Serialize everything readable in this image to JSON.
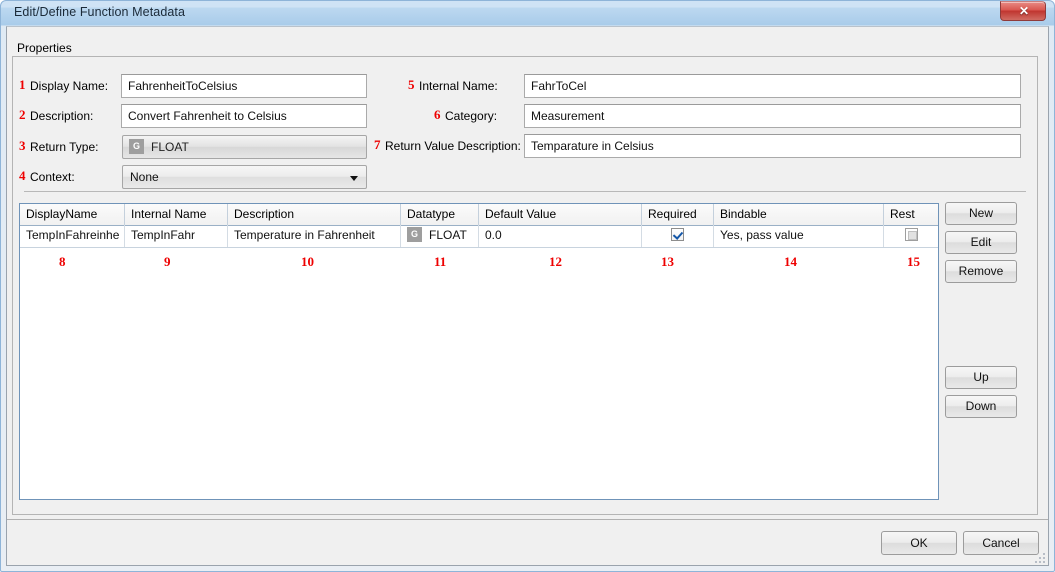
{
  "window": {
    "title": "Edit/Define Function Metadata",
    "close_label": "✕"
  },
  "group": {
    "title": "Properties"
  },
  "fields": {
    "display_name": {
      "number": "1",
      "label": "Display Name:",
      "value": "FahrenheitToCelsius"
    },
    "description": {
      "number": "2",
      "label": "Description:",
      "value": "Convert Fahrenheit to Celsius"
    },
    "return_type": {
      "number": "3",
      "label": "Return Type:",
      "badge": "G",
      "value": "FLOAT"
    },
    "context": {
      "number": "4",
      "label": "Context:",
      "value": "None"
    },
    "internal_name": {
      "number": "5",
      "label": "Internal Name:",
      "value": "FahrToCel"
    },
    "category": {
      "number": "6",
      "label": "Category:",
      "value": "Measurement"
    },
    "return_value_description": {
      "number": "7",
      "label": "Return Value Description:",
      "value": "Temparature in Celsius"
    }
  },
  "table": {
    "columns": [
      "DisplayName",
      "Internal Name",
      "Description",
      "Datatype",
      "Default Value",
      "Required",
      "Bindable",
      "Rest"
    ],
    "column_numbers": [
      "8",
      "9",
      "10",
      "11",
      "12",
      "13",
      "14",
      "15"
    ],
    "rows": [
      {
        "display_name": "TempInFahreinhe",
        "internal_name": "TempInFahr",
        "description": "Temperature in Fahrenheit",
        "datatype_badge": "G",
        "datatype": "FLOAT",
        "default_value": "0.0",
        "required_checked": true,
        "bindable": "Yes, pass value",
        "rest_checked": false
      }
    ]
  },
  "side_buttons": {
    "new": "New",
    "edit": "Edit",
    "remove": "Remove",
    "up": "Up",
    "down": "Down"
  },
  "footer": {
    "ok": "OK",
    "cancel": "Cancel"
  },
  "colors": {
    "annotation_red": "#ee0000",
    "titlebar_blue": "#a9ccea",
    "table_border": "#6f93b8",
    "close_red": "#c0352f"
  }
}
